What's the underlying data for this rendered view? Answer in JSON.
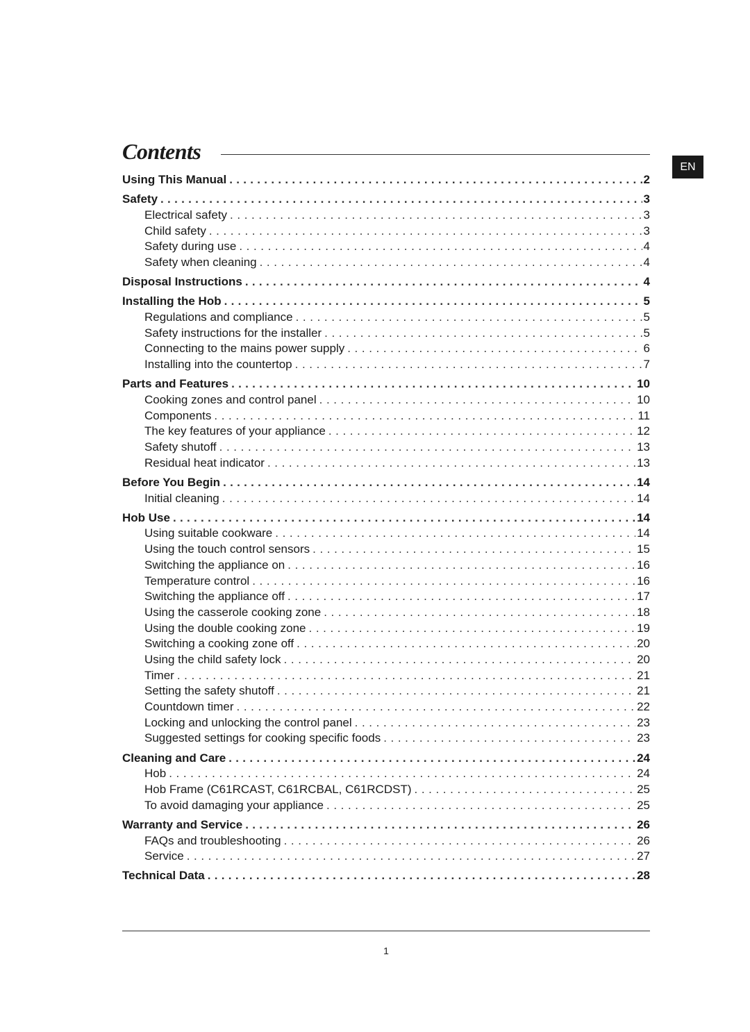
{
  "title": "Contents",
  "language_tab": "EN",
  "page_number": "1",
  "entries": [
    {
      "label": "Using This Manual",
      "page": "2",
      "level": 1
    },
    {
      "label": "Safety",
      "page": "3",
      "level": 1
    },
    {
      "label": "Electrical safety",
      "page": "3",
      "level": 2
    },
    {
      "label": "Child safety",
      "page": "3",
      "level": 2
    },
    {
      "label": "Safety during use",
      "page": "4",
      "level": 2
    },
    {
      "label": "Safety when cleaning",
      "page": "4",
      "level": 2
    },
    {
      "label": "Disposal Instructions",
      "page": "4",
      "level": 1
    },
    {
      "label": "Installing the Hob",
      "page": "5",
      "level": 1
    },
    {
      "label": "Regulations and compliance",
      "page": "5",
      "level": 2
    },
    {
      "label": "Safety instructions for the installer",
      "page": "5",
      "level": 2
    },
    {
      "label": "Connecting to the mains power supply",
      "page": "6",
      "level": 2
    },
    {
      "label": "Installing into the countertop",
      "page": "7",
      "level": 2
    },
    {
      "label": "Parts and Features",
      "page": "10",
      "level": 1
    },
    {
      "label": "Cooking zones and control panel",
      "page": "10",
      "level": 2
    },
    {
      "label": "Components",
      "page": "11",
      "level": 2
    },
    {
      "label": "The key features of your appliance",
      "page": "12",
      "level": 2
    },
    {
      "label": "Safety shutoff",
      "page": "13",
      "level": 2
    },
    {
      "label": "Residual heat indicator",
      "page": "13",
      "level": 2
    },
    {
      "label": "Before You Begin",
      "page": "14",
      "level": 1
    },
    {
      "label": "Initial cleaning",
      "page": "14",
      "level": 2
    },
    {
      "label": "Hob Use",
      "page": "14",
      "level": 1
    },
    {
      "label": "Using suitable cookware",
      "page": "14",
      "level": 2
    },
    {
      "label": "Using the touch control sensors",
      "page": "15",
      "level": 2
    },
    {
      "label": "Switching the appliance on",
      "page": "16",
      "level": 2
    },
    {
      "label": "Temperature control",
      "page": "16",
      "level": 2
    },
    {
      "label": "Switching the appliance off",
      "page": "17",
      "level": 2
    },
    {
      "label": "Using the casserole cooking zone",
      "page": "18",
      "level": 2
    },
    {
      "label": "Using the double cooking zone",
      "page": "19",
      "level": 2
    },
    {
      "label": "Switching a cooking zone off",
      "page": "20",
      "level": 2
    },
    {
      "label": "Using the child safety lock",
      "page": "20",
      "level": 2
    },
    {
      "label": "Timer",
      "page": "21",
      "level": 2
    },
    {
      "label": "Setting the safety shutoff",
      "page": "21",
      "level": 2
    },
    {
      "label": "Countdown timer",
      "page": "22",
      "level": 2
    },
    {
      "label": "Locking and unlocking the control panel",
      "page": "23",
      "level": 2
    },
    {
      "label": "Suggested settings for cooking specific foods",
      "page": "23",
      "level": 2
    },
    {
      "label": "Cleaning and Care",
      "page": "24",
      "level": 1
    },
    {
      "label": "Hob",
      "page": "24",
      "level": 2
    },
    {
      "label": "Hob Frame (C61RCAST, C61RCBAL, C61RCDST)",
      "page": "25",
      "level": 2
    },
    {
      "label": "To avoid damaging your appliance",
      "page": "25",
      "level": 2
    },
    {
      "label": "Warranty and Service",
      "page": "26",
      "level": 1
    },
    {
      "label": "FAQs and troubleshooting",
      "page": "26",
      "level": 2
    },
    {
      "label": "Service",
      "page": "27",
      "level": 2
    },
    {
      "label": "Technical Data",
      "page": "28",
      "level": 1
    }
  ]
}
